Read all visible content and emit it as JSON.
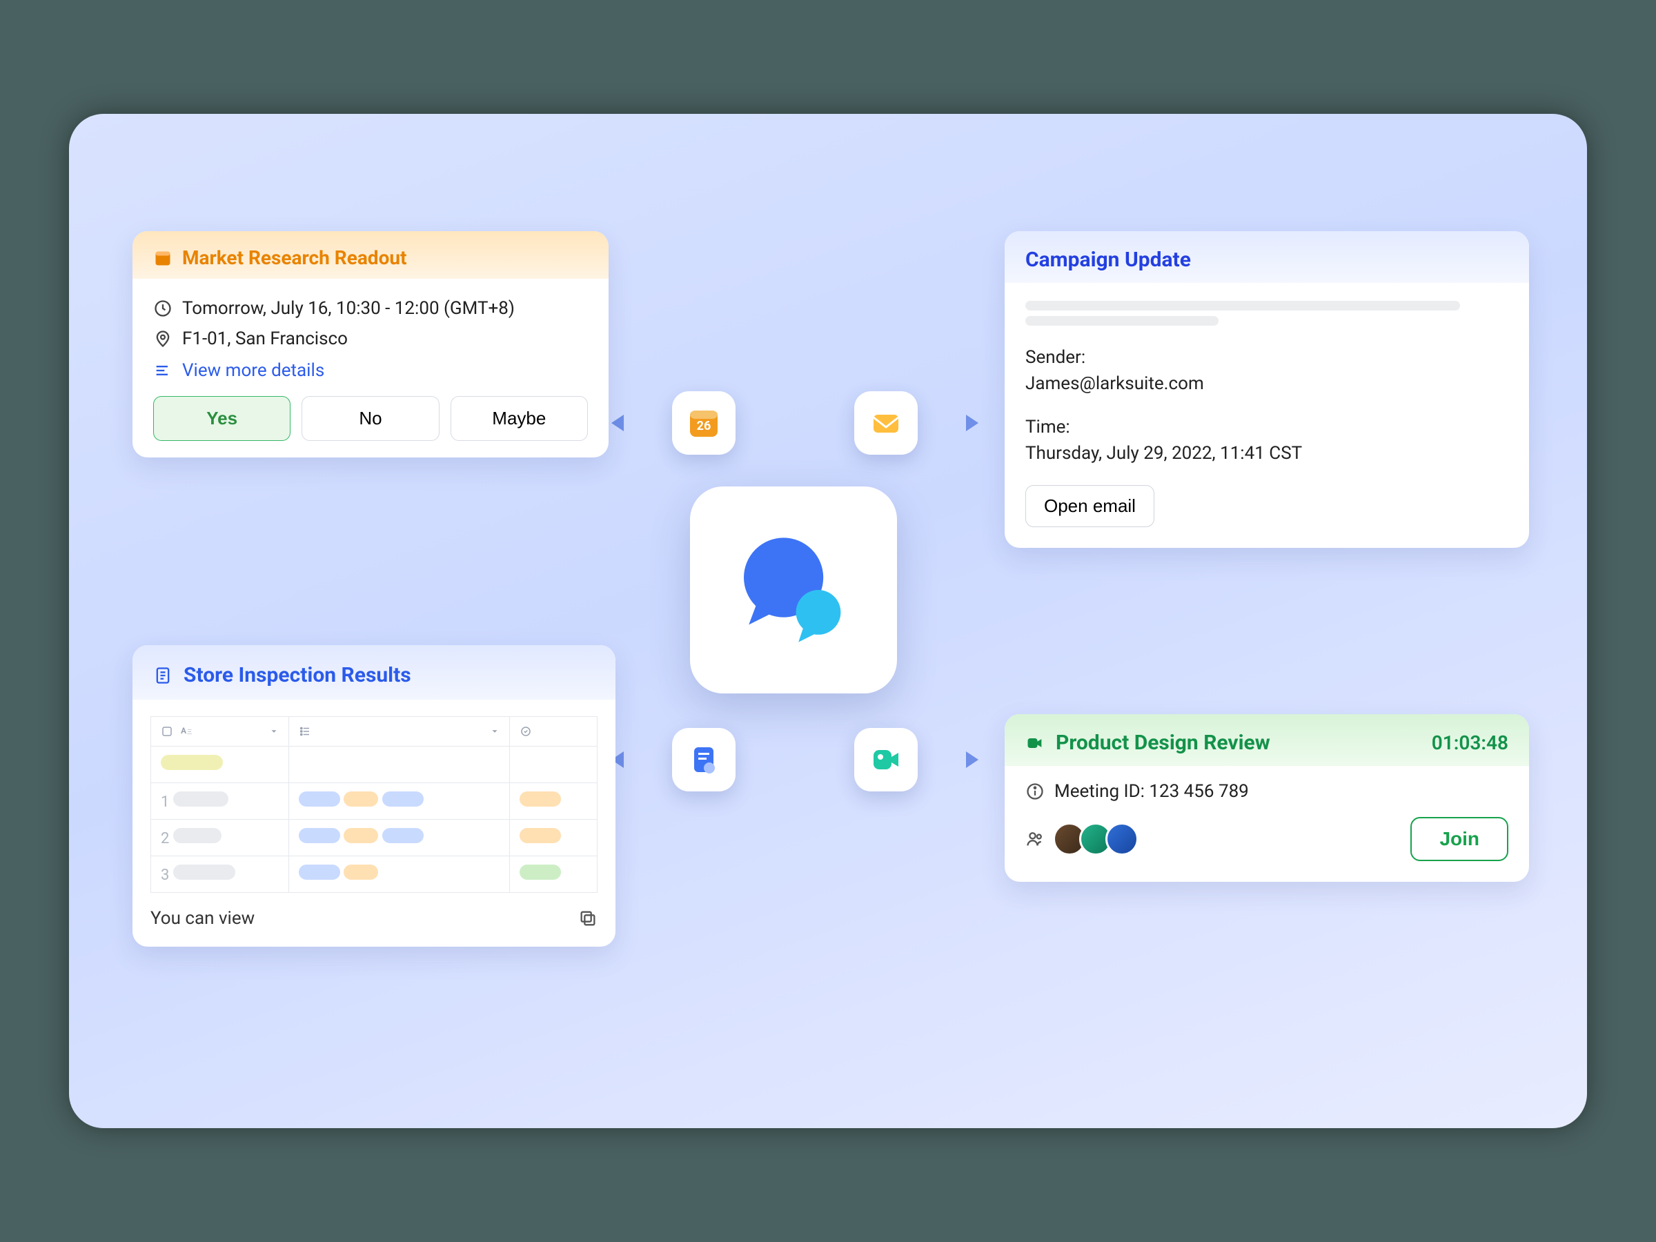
{
  "market": {
    "title": "Market Research Readout",
    "when": "Tomorrow, July 16, 10:30 - 12:00 (GMT+8)",
    "where": "F1-01, San Francisco",
    "more_link": "View more details",
    "yes_label": "Yes",
    "no_label": "No",
    "maybe_label": "Maybe"
  },
  "campaign": {
    "title": "Campaign Update",
    "sender_label": "Sender:",
    "sender_value": "James@larksuite.com",
    "time_label": "Time:",
    "time_value": "Thursday, July 29, 2022, 11:41 CST",
    "open_label": "Open email"
  },
  "store": {
    "title": "Store Inspection Results",
    "footer_text": "You can view"
  },
  "meeting": {
    "title": "Product Design Review",
    "timer": "01:03:48",
    "meeting_id_label": "Meeting ID: 123 456 789",
    "join_label": "Join"
  },
  "calendar_day": "26"
}
